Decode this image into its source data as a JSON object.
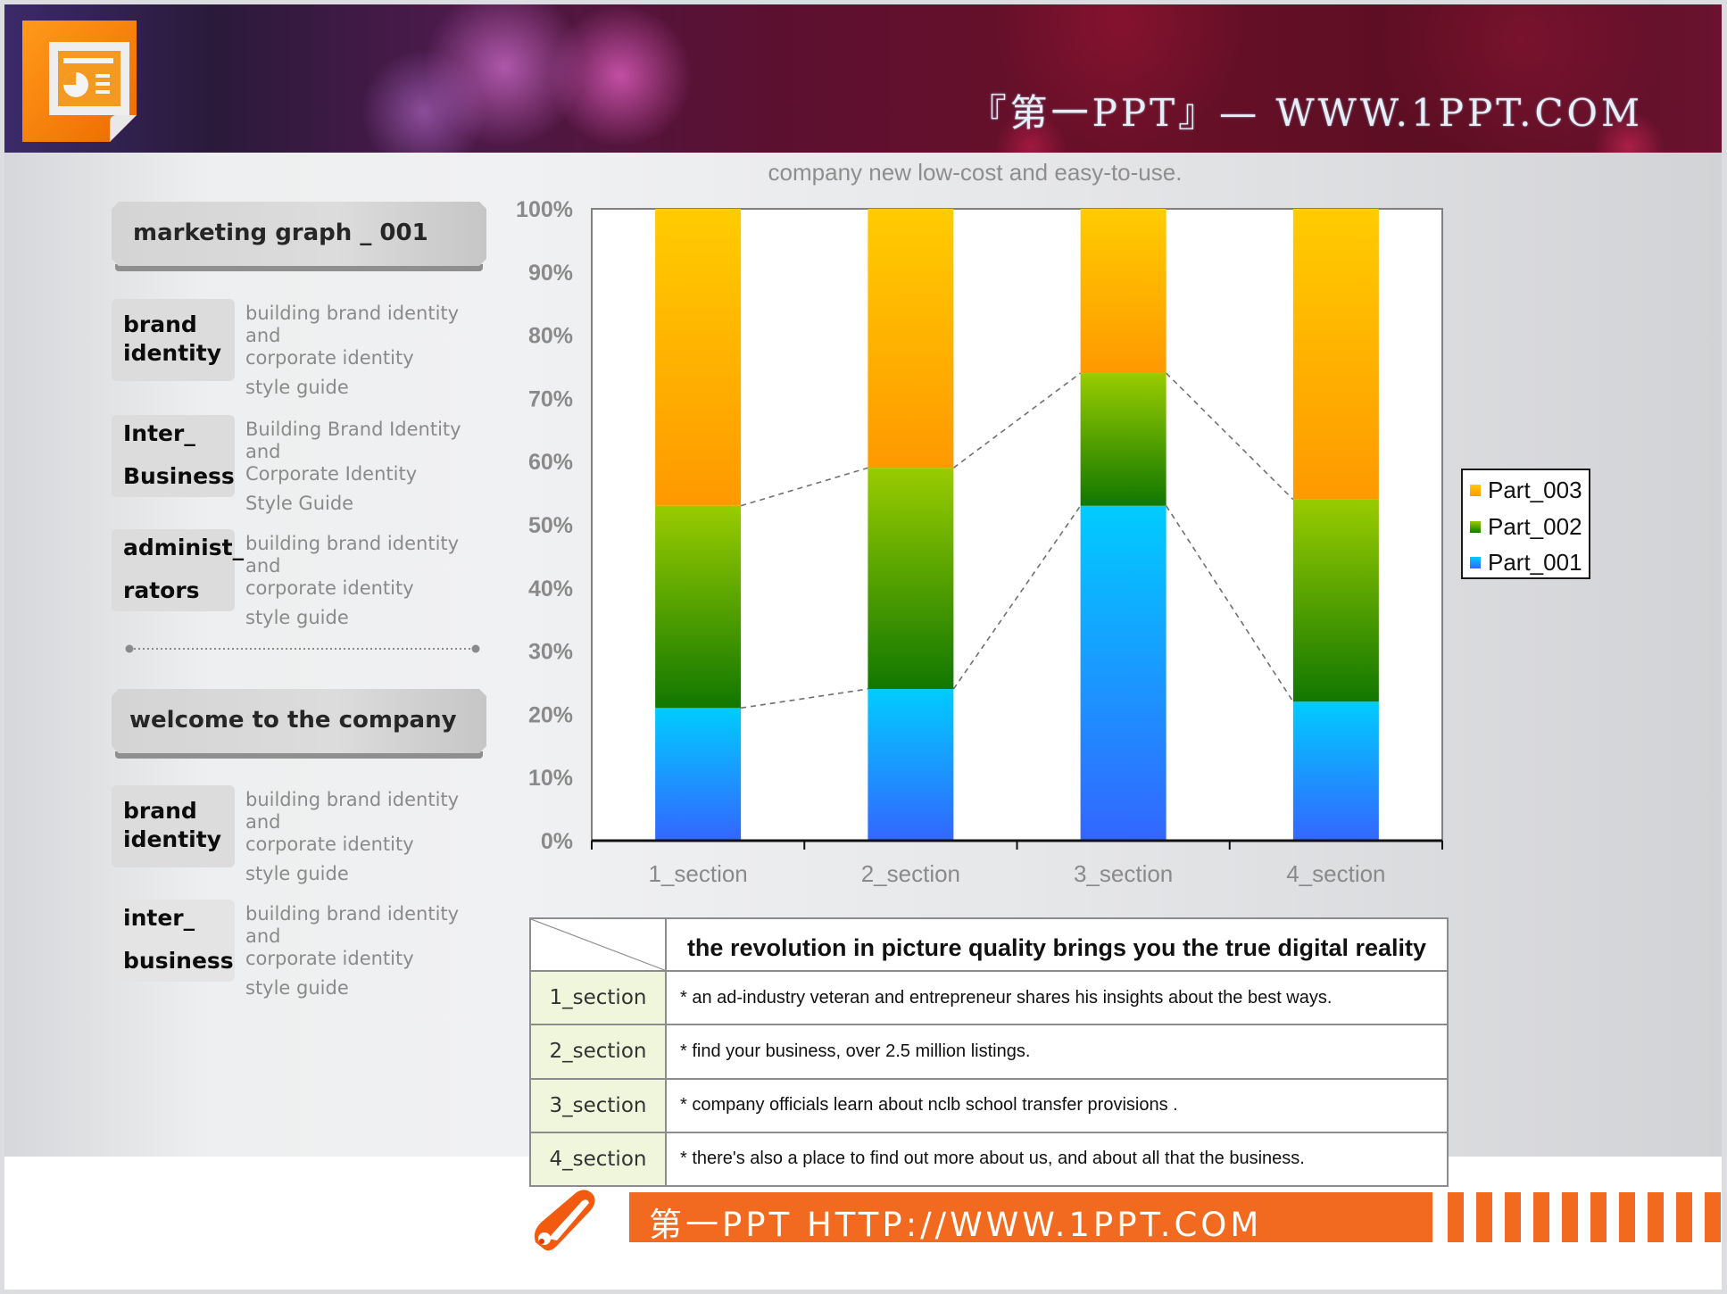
{
  "header": {
    "title": "『第一PPT』— WWW.1PPT.COM",
    "logo_icon": "presentation-file-icon"
  },
  "subtitle": "company new low-cost and easy-to-use.",
  "left_panel": {
    "section1": {
      "title": "marketing graph _ 001",
      "items": [
        {
          "tag_line1": "brand",
          "tag_line2": "identity",
          "desc_line1": "building brand identity and",
          "desc_line2": "corporate identity",
          "desc_line3": "style guide"
        },
        {
          "tag_line1": "Inter_",
          "tag_line2": "Business",
          "desc_line1": "Building Brand Identity and",
          "desc_line2": "Corporate Identity",
          "desc_line3": "Style Guide"
        },
        {
          "tag_line1": "administ_",
          "tag_line2": "rators",
          "desc_line1": "building brand identity and",
          "desc_line2": "corporate identity",
          "desc_line3": "style guide"
        }
      ]
    },
    "section2": {
      "title": "welcome to the company",
      "items": [
        {
          "tag_line1": "brand",
          "tag_line2": "identity",
          "desc_line1": "building brand identity and",
          "desc_line2": "corporate identity",
          "desc_line3": "style guide"
        },
        {
          "tag_line1": "inter_",
          "tag_line2": "business",
          "desc_line1": "building brand identity and",
          "desc_line2": "corporate identity",
          "desc_line3": "style guide"
        }
      ]
    }
  },
  "chart_data": {
    "type": "bar",
    "stacked": "percent",
    "title": "company new low-cost and easy-to-use.",
    "categories": [
      "1_section",
      "2_section",
      "3_section",
      "4_section"
    ],
    "series": [
      {
        "name": "Part_001",
        "values": [
          21,
          24,
          53,
          22
        ],
        "color_top": "#00ccff",
        "color_bottom": "#3366ff"
      },
      {
        "name": "Part_002",
        "values": [
          32,
          35,
          21,
          32
        ],
        "color_top": "#99cc00",
        "color_bottom": "#117700"
      },
      {
        "name": "Part_003",
        "values": [
          47,
          41,
          26,
          46
        ],
        "color_top": "#ffcc00",
        "color_bottom": "#ff9900"
      }
    ],
    "yticks": [
      "0%",
      "10%",
      "20%",
      "30%",
      "40%",
      "50%",
      "60%",
      "70%",
      "80%",
      "90%",
      "100%"
    ],
    "ylim": [
      0,
      100
    ],
    "xlabel": "",
    "ylabel": "",
    "grid": false,
    "series_lines": "dashed",
    "legend": {
      "position": "right",
      "order": [
        "Part_003",
        "Part_002",
        "Part_001"
      ]
    }
  },
  "table": {
    "header": "the revolution in picture quality brings you the true digital reality",
    "rows": [
      {
        "label": "1_section",
        "text": "* an ad-industry veteran and entrepreneur shares his insights about the best ways."
      },
      {
        "label": "2_section",
        "text": "* find your business, over 2.5 million listings."
      },
      {
        "label": "3_section",
        "text": "* company officials learn about nclb school transfer provisions ."
      },
      {
        "label": "4_section",
        "text": "* there's also a place to find out more about us, and about all that the business."
      }
    ]
  },
  "footer": {
    "text": "第一PPT HTTP://WWW.1PPT.COM",
    "icon": "pencil-icon"
  }
}
